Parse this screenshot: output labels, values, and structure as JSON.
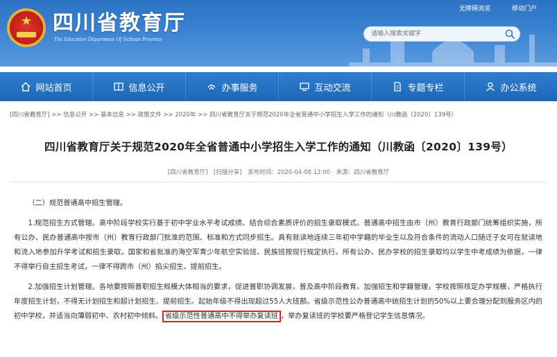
{
  "header": {
    "site_title": "四川省教育厅",
    "site_subtitle": "The Education Department Of Sichuan Province",
    "top_links": [
      "无障碍浏览",
      "移动门户"
    ],
    "search_placeholder": "请输入搜索关键字"
  },
  "nav": {
    "items": [
      {
        "label": "网站首页",
        "icon": "home-icon"
      },
      {
        "label": "信息公开",
        "icon": "book-icon"
      },
      {
        "label": "办事服务",
        "icon": "service-icon"
      },
      {
        "label": "互动交流",
        "icon": "monitor-icon"
      },
      {
        "label": "专题专栏",
        "icon": "document-icon"
      },
      {
        "label": "办公系统",
        "icon": "user-icon"
      }
    ]
  },
  "breadcrumb": {
    "items": [
      "[四川省教育厅]",
      "信息公开",
      "基本信息",
      "政策文件",
      "2020年",
      "四川省教育厅关于规范2020年全省普通中小学招生入学工作的通知（川教函〔2020〕139号）"
    ],
    "separator": " >> "
  },
  "article": {
    "title": "四川省教育厅关于规范2020年全省普通中小学招生入学工作的通知（川教函〔2020〕139号）",
    "meta": "[四川省教育厅]　[扫描分享]　发布时间：2020-04-08 12:00　来源：四川省教育厅",
    "section_heading": "（二）规范普通高中招生管理。",
    "para1": "1.规范招生方式管理。高中阶段学校实行基于初中学业水平考试成绩、结合综合素质评价的招生录取模式。普通高中招生由市（州）教育行政部门统筹组织实施，所有公办、民办普通高中按市（州）教育行政部门批准的范围、标准和方式同步招生。具有就读地连续三年初中学籍的毕业生以及符合条件的流动人口随迁子女可在就读地和流入地参加升学考试和招生录取。国家和省批准的海空军青少年航空实验班、民族班按现行规定执行。所有公办、民办学校的招生录取均以学生中考成绩为依据，一律不得举行自主招生考试，一律不得跨市（州）掐尖招生、提前招生。",
    "para2_before": "2.加强招生计划管理。各地要按照普职招生规模大体相当的要求，促进普职协调发展，普及高中阶段教育。加强招生和学籍管理，学校按照核定办学规模，严格执行年度招生计划，不得无计划招生和超计划招生、提前招生。起始年级不得出现超过55人大班额。省级示范性公办普通高中统招生计划的50%以上要合理分配到服务区内的初中学校，并适当向薄弱初中、农村初中倾斜。",
    "para2_highlight": "省级示范性普通高中不得举办复读班",
    "para2_after": "，举办复读班的学校要严格登记学生信息情况。"
  },
  "colors": {
    "header_blue": "#3f86d4",
    "nav_blue": "#1f66b6",
    "highlight_border": "#e02020"
  }
}
